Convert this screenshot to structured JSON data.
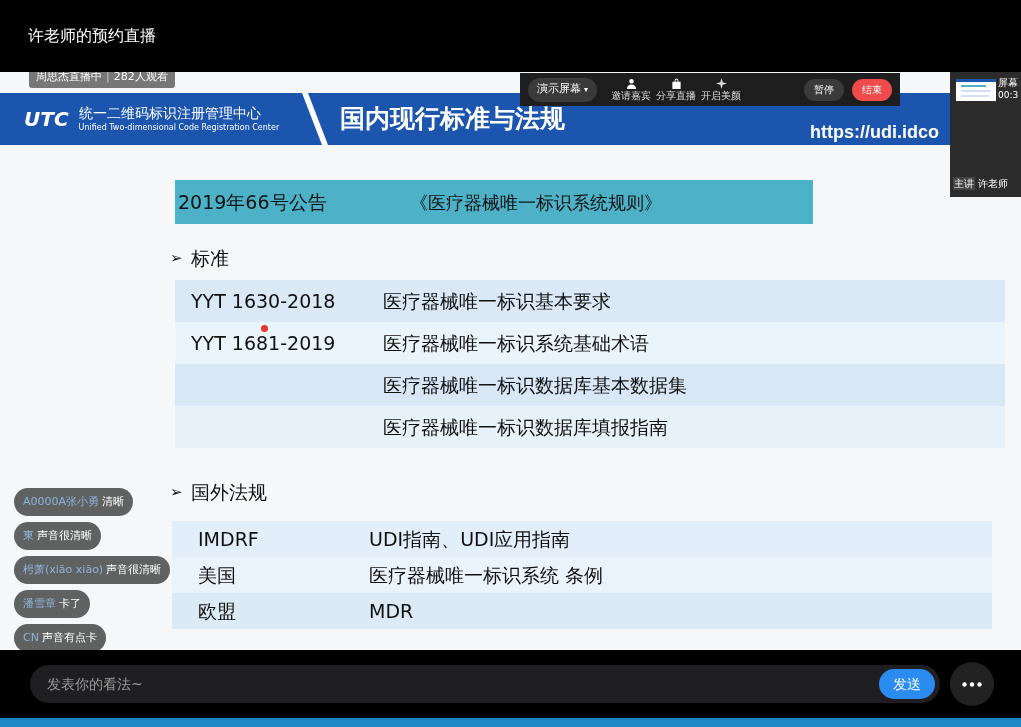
{
  "window": {
    "title": "许老师的预约直播"
  },
  "stream_tag": {
    "host": "周思杰直播中",
    "separator": "|",
    "viewers": "282人观看"
  },
  "toolbar": {
    "screen_button": "演示屏幕",
    "caret": "▾",
    "tools": [
      {
        "kind": "person",
        "label": "邀请嘉宾"
      },
      {
        "kind": "bag",
        "label": "分享直播"
      },
      {
        "kind": "sparkle",
        "label": "开启美颜"
      }
    ],
    "pause": "暂停",
    "end": "结束"
  },
  "preview": {
    "title": "屏幕",
    "time": "00:3",
    "badge": "主讲",
    "name": "许老师"
  },
  "slide": {
    "logo": "UTC",
    "org_name": "统一二维码标识注册管理中心",
    "org_name_en": "Unified Two-dimensional Code Registration Center",
    "title": "国内现行标准与法规",
    "url": "https://udi.idco",
    "notice": {
      "number": "2019年66号公告",
      "name": "《医疗器械唯一标识系统规则》"
    },
    "sections": [
      {
        "bullet": "➢",
        "heading": "标准",
        "rows": [
          {
            "code": "YYT 1630-2018",
            "name": "医疗器械唯一标识基本要求"
          },
          {
            "code": "YYT 1681-2019",
            "name": "医疗器械唯一标识系统基础术语"
          },
          {
            "name": "医疗器械唯一标识数据库基本数据集"
          },
          {
            "name": "医疗器械唯一标识数据库填报指南"
          }
        ]
      },
      {
        "bullet": "➢",
        "heading": "国外法规",
        "rows": [
          {
            "code": "IMDRF",
            "name": "UDI指南、UDI应用指南"
          },
          {
            "code": "美国",
            "name": "医疗器械唯一标识系统 条例"
          },
          {
            "code": "欧盟",
            "name": "MDR"
          }
        ]
      }
    ]
  },
  "comments": [
    {
      "user": "A0000A张小勇",
      "text": "清晰"
    },
    {
      "user": "東",
      "text": "声音很清晰"
    },
    {
      "user": "枵萧(xiāo xiāo)",
      "text": "声音很清晰"
    },
    {
      "user": "潘雪章",
      "text": "卡了"
    },
    {
      "user": "CN",
      "text": "声音有点卡"
    }
  ],
  "composer": {
    "placeholder": "发表你的看法~",
    "send": "发送"
  }
}
